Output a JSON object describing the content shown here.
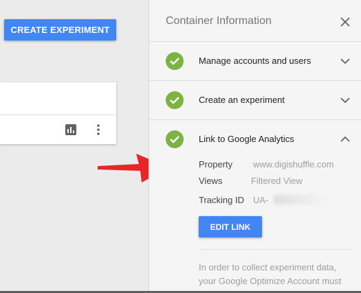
{
  "toolbar": {
    "create_experiment_label": "CREATE EXPERIMENT"
  },
  "panel": {
    "title": "Container Information",
    "steps": [
      {
        "label": "Manage accounts and users",
        "status": "complete",
        "expanded": false
      },
      {
        "label": "Create an experiment",
        "status": "complete",
        "expanded": false
      },
      {
        "label": "Link to Google Analytics",
        "status": "complete",
        "expanded": true
      }
    ],
    "link_details": {
      "property_label": "Property",
      "property_value": "www.digishuffle.com",
      "views_label": "Views",
      "views_value": "Filtered View",
      "tracking_label": "Tracking ID",
      "tracking_value": "UA-"
    },
    "edit_link_label": "EDIT LINK",
    "info_text_line1": "In order to collect experiment data,",
    "info_text_line2": "your Google Optimize Account must"
  },
  "colors": {
    "primary_button": "#4285f4",
    "check_green": "#7cb342",
    "annotation_arrow": "#e8262a"
  },
  "icons": [
    "report-icon",
    "kebab-menu-icon",
    "close-icon",
    "check-icon",
    "chevron-down-icon",
    "chevron-up-icon"
  ]
}
